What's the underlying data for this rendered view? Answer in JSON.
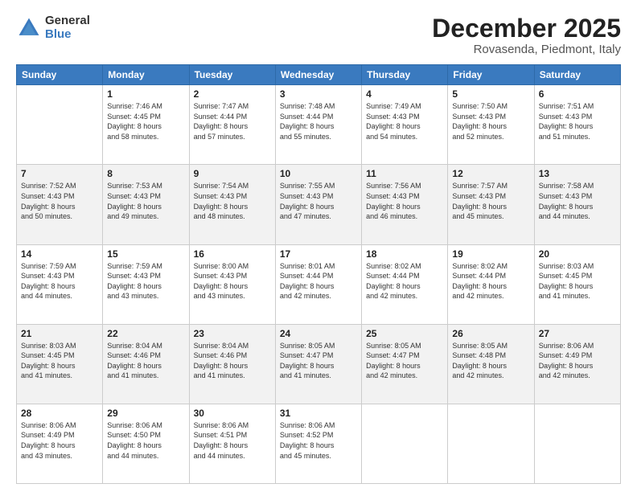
{
  "logo": {
    "general": "General",
    "blue": "Blue"
  },
  "title": {
    "month": "December 2025",
    "location": "Rovasenda, Piedmont, Italy"
  },
  "days_header": [
    "Sunday",
    "Monday",
    "Tuesday",
    "Wednesday",
    "Thursday",
    "Friday",
    "Saturday"
  ],
  "weeks": [
    {
      "shade": "white",
      "days": [
        {
          "num": "",
          "info": ""
        },
        {
          "num": "1",
          "info": "Sunrise: 7:46 AM\nSunset: 4:45 PM\nDaylight: 8 hours\nand 58 minutes."
        },
        {
          "num": "2",
          "info": "Sunrise: 7:47 AM\nSunset: 4:44 PM\nDaylight: 8 hours\nand 57 minutes."
        },
        {
          "num": "3",
          "info": "Sunrise: 7:48 AM\nSunset: 4:44 PM\nDaylight: 8 hours\nand 55 minutes."
        },
        {
          "num": "4",
          "info": "Sunrise: 7:49 AM\nSunset: 4:43 PM\nDaylight: 8 hours\nand 54 minutes."
        },
        {
          "num": "5",
          "info": "Sunrise: 7:50 AM\nSunset: 4:43 PM\nDaylight: 8 hours\nand 52 minutes."
        },
        {
          "num": "6",
          "info": "Sunrise: 7:51 AM\nSunset: 4:43 PM\nDaylight: 8 hours\nand 51 minutes."
        }
      ]
    },
    {
      "shade": "shaded",
      "days": [
        {
          "num": "7",
          "info": "Sunrise: 7:52 AM\nSunset: 4:43 PM\nDaylight: 8 hours\nand 50 minutes."
        },
        {
          "num": "8",
          "info": "Sunrise: 7:53 AM\nSunset: 4:43 PM\nDaylight: 8 hours\nand 49 minutes."
        },
        {
          "num": "9",
          "info": "Sunrise: 7:54 AM\nSunset: 4:43 PM\nDaylight: 8 hours\nand 48 minutes."
        },
        {
          "num": "10",
          "info": "Sunrise: 7:55 AM\nSunset: 4:43 PM\nDaylight: 8 hours\nand 47 minutes."
        },
        {
          "num": "11",
          "info": "Sunrise: 7:56 AM\nSunset: 4:43 PM\nDaylight: 8 hours\nand 46 minutes."
        },
        {
          "num": "12",
          "info": "Sunrise: 7:57 AM\nSunset: 4:43 PM\nDaylight: 8 hours\nand 45 minutes."
        },
        {
          "num": "13",
          "info": "Sunrise: 7:58 AM\nSunset: 4:43 PM\nDaylight: 8 hours\nand 44 minutes."
        }
      ]
    },
    {
      "shade": "white",
      "days": [
        {
          "num": "14",
          "info": "Sunrise: 7:59 AM\nSunset: 4:43 PM\nDaylight: 8 hours\nand 44 minutes."
        },
        {
          "num": "15",
          "info": "Sunrise: 7:59 AM\nSunset: 4:43 PM\nDaylight: 8 hours\nand 43 minutes."
        },
        {
          "num": "16",
          "info": "Sunrise: 8:00 AM\nSunset: 4:43 PM\nDaylight: 8 hours\nand 43 minutes."
        },
        {
          "num": "17",
          "info": "Sunrise: 8:01 AM\nSunset: 4:44 PM\nDaylight: 8 hours\nand 42 minutes."
        },
        {
          "num": "18",
          "info": "Sunrise: 8:02 AM\nSunset: 4:44 PM\nDaylight: 8 hours\nand 42 minutes."
        },
        {
          "num": "19",
          "info": "Sunrise: 8:02 AM\nSunset: 4:44 PM\nDaylight: 8 hours\nand 42 minutes."
        },
        {
          "num": "20",
          "info": "Sunrise: 8:03 AM\nSunset: 4:45 PM\nDaylight: 8 hours\nand 41 minutes."
        }
      ]
    },
    {
      "shade": "shaded",
      "days": [
        {
          "num": "21",
          "info": "Sunrise: 8:03 AM\nSunset: 4:45 PM\nDaylight: 8 hours\nand 41 minutes."
        },
        {
          "num": "22",
          "info": "Sunrise: 8:04 AM\nSunset: 4:46 PM\nDaylight: 8 hours\nand 41 minutes."
        },
        {
          "num": "23",
          "info": "Sunrise: 8:04 AM\nSunset: 4:46 PM\nDaylight: 8 hours\nand 41 minutes."
        },
        {
          "num": "24",
          "info": "Sunrise: 8:05 AM\nSunset: 4:47 PM\nDaylight: 8 hours\nand 41 minutes."
        },
        {
          "num": "25",
          "info": "Sunrise: 8:05 AM\nSunset: 4:47 PM\nDaylight: 8 hours\nand 42 minutes."
        },
        {
          "num": "26",
          "info": "Sunrise: 8:05 AM\nSunset: 4:48 PM\nDaylight: 8 hours\nand 42 minutes."
        },
        {
          "num": "27",
          "info": "Sunrise: 8:06 AM\nSunset: 4:49 PM\nDaylight: 8 hours\nand 42 minutes."
        }
      ]
    },
    {
      "shade": "white",
      "days": [
        {
          "num": "28",
          "info": "Sunrise: 8:06 AM\nSunset: 4:49 PM\nDaylight: 8 hours\nand 43 minutes."
        },
        {
          "num": "29",
          "info": "Sunrise: 8:06 AM\nSunset: 4:50 PM\nDaylight: 8 hours\nand 44 minutes."
        },
        {
          "num": "30",
          "info": "Sunrise: 8:06 AM\nSunset: 4:51 PM\nDaylight: 8 hours\nand 44 minutes."
        },
        {
          "num": "31",
          "info": "Sunrise: 8:06 AM\nSunset: 4:52 PM\nDaylight: 8 hours\nand 45 minutes."
        },
        {
          "num": "",
          "info": ""
        },
        {
          "num": "",
          "info": ""
        },
        {
          "num": "",
          "info": ""
        }
      ]
    }
  ]
}
